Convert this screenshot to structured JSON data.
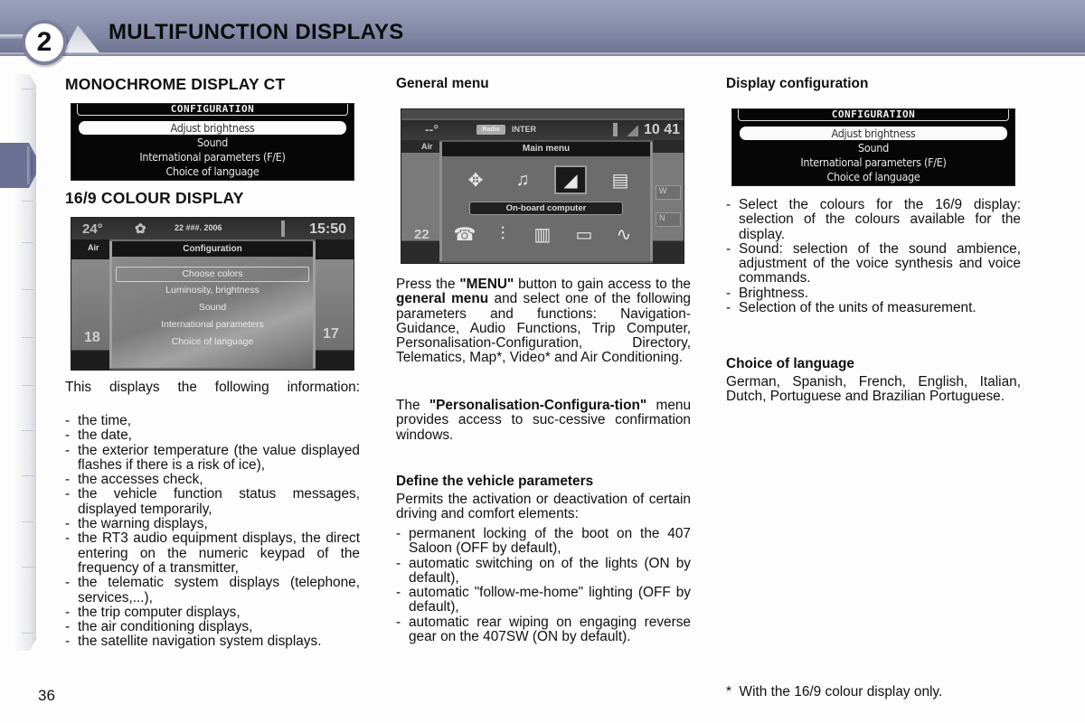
{
  "header": {
    "chapter_number": "2",
    "title": "MULTIFUNCTION DISPLAYS"
  },
  "page_number": "36",
  "col1": {
    "mono_heading": "MONOCHROME DISPLAY CT",
    "mono_screen": {
      "title": "CONFIGURATION",
      "items": [
        "Adjust brightness",
        "Sound",
        "International parameters (F/E)",
        "Choice of language"
      ],
      "selected_index": 0
    },
    "colour_heading": "16/9 COLOUR DISPLAY",
    "colour_screen": {
      "temperature": "24°",
      "date": "22 ###. 2006",
      "time": "15:50",
      "left_label": "Air",
      "left_value": "18",
      "right_value": "17",
      "popup_title": "Configuration",
      "items": [
        "Choose colors",
        "Luminosity, brightness",
        "Sound",
        "International parameters",
        "Choice of language"
      ],
      "selected_index": 0
    },
    "intro": "This displays the following information:",
    "bullets": [
      "the time,",
      "the date,",
      "the exterior temperature (the value displayed flashes if there is a risk of ice),",
      "the accesses check,",
      "the vehicle function status messages, displayed temporarily,",
      "the warning displays,",
      "the RT3 audio equipment displays, the direct entering on the numeric keypad of the frequency of a transmitter,",
      "the telematic system displays (telephone, services,...),",
      "the trip computer displays,",
      "the air conditioning displays,",
      "the satellite navigation system displays."
    ]
  },
  "col2": {
    "heading": "General menu",
    "menu_screen": {
      "status_left": "--°",
      "source_badge": "Radio",
      "source_label": "INTER",
      "time": "10 41",
      "left_label": "Air",
      "left_value": "22",
      "right_label_1": "W",
      "right_label_2": "N",
      "popup_title": "Main menu",
      "top_icons": [
        "navigation-icon",
        "audio-icon",
        "trip-computer-icon",
        "directory-icon"
      ],
      "top_icon_glyphs": [
        "✥",
        "♫",
        "◢",
        "▤"
      ],
      "selected_icon_index": 2,
      "selected_label": "On-board computer",
      "bottom_icons": [
        "telephone-icon",
        "settings-sliders-icon",
        "map-icon",
        "video-icon",
        "air-conditioning-icon"
      ],
      "bottom_icon_glyphs": [
        "☎",
        "⫶",
        "▥",
        "▭",
        "∿"
      ]
    },
    "para1_a": "Press the ",
    "para1_b": "\"MENU\"",
    "para1_c": " button to gain access to the ",
    "para1_d": "general menu",
    "para1_e": " and select one of the following parameters and functions: Navigation-Guidance, Audio Functions, Trip Computer, Personalisation-Configuration, Directory, Telematics, Map*, Video* and Air Conditioning.",
    "para2_a": "The ",
    "para2_b": "\"Personalisation-Configura-tion\"",
    "para2_c": " menu provides access to suc-cessive confirmation windows.",
    "sub_heading": "Define the vehicle parameters",
    "sub_intro": "Permits the activation or deactivation of certain driving and comfort elements:",
    "bullets": [
      "permanent locking of the boot on the 407 Saloon (OFF by default),",
      "automatic switching on of the lights (ON by default),",
      "automatic \"follow-me-home\" lighting (OFF by default),",
      "automatic rear wiping on engaging reverse gear on the 407SW (ON by default)."
    ]
  },
  "col3": {
    "heading": "Display configuration",
    "mono_screen": {
      "title": "CONFIGURATION",
      "items": [
        "Adjust brightness",
        "Sound",
        "International parameters (F/E)",
        "Choice of language"
      ],
      "selected_index": 0
    },
    "bullets": [
      "Select the colours for the 16/9 display: selection of the colours available for the display.",
      "Sound: selection of the sound ambience, adjustment of the voice synthesis and voice commands.",
      "Brightness.",
      "Selection of the units of measurement."
    ],
    "language_heading": "Choice of language",
    "language_text": "German, Spanish, French, English, Italian, Dutch, Portuguese and Brazilian Portuguese.",
    "footnote": "*  With the 16/9 colour display only."
  }
}
